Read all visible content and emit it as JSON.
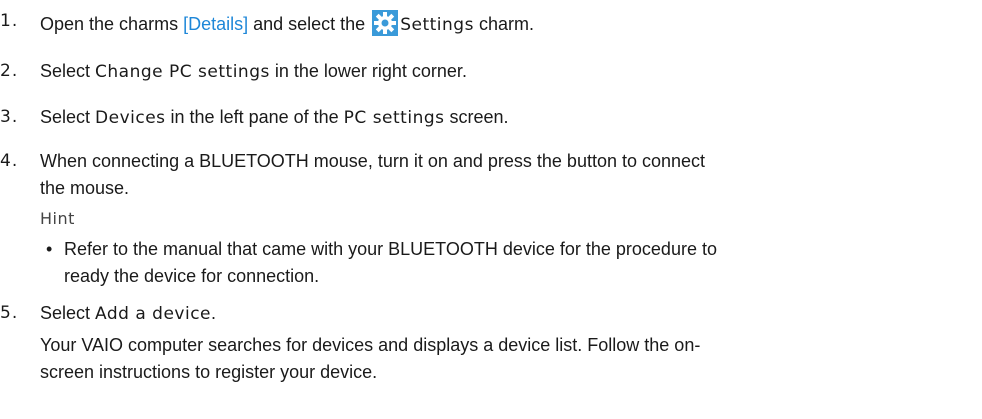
{
  "steps": [
    {
      "num": "1.",
      "before": "Open the charms ",
      "link": "[Details]",
      "middle": " and select the ",
      "icon": "settings-gear-icon",
      "ui": "Settings",
      "after": " charm."
    },
    {
      "num": "2.",
      "before": "Select ",
      "ui": "Change PC settings",
      "after": " in the lower right corner."
    },
    {
      "num": "3.",
      "before": "Select ",
      "ui": "Devices",
      "middle": " in the left pane of the ",
      "ui2": "PC settings",
      "after": " screen."
    },
    {
      "num": "4.",
      "line1": "When connecting a BLUETOOTH mouse, turn it on and press the button to connect",
      "line2": "the mouse.",
      "hint_label": "Hint",
      "bullet_line1": "Refer to the manual that came with your BLUETOOTH device for the procedure to",
      "bullet_line2": "ready the device for connection."
    },
    {
      "num": "5.",
      "before": "Select ",
      "ui": "Add a device",
      "after": ".",
      "desc_line1": "Your VAIO computer searches for devices and displays a device list. Follow the on-",
      "desc_line2": "screen instructions to register your device."
    }
  ],
  "colors": {
    "link": "#1e87d8",
    "icon_bg": "#3a9ad9",
    "text": "#1a1a1a"
  }
}
